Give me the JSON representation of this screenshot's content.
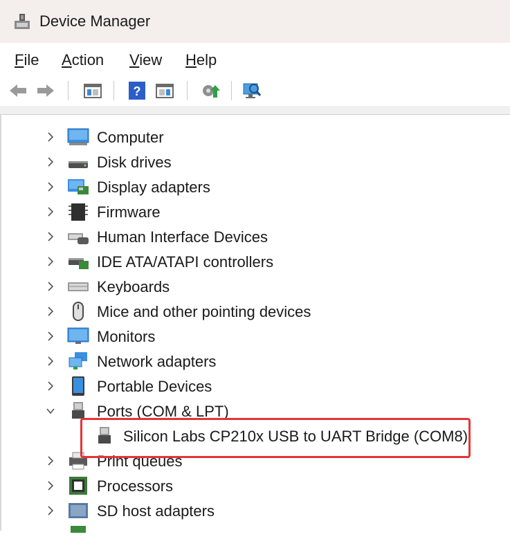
{
  "window": {
    "title": "Device Manager",
    "icon": "device-manager-icon"
  },
  "menu": [
    {
      "label": "File",
      "mnemonic": "F",
      "rest": "ile"
    },
    {
      "label": "Action",
      "mnemonic": "A",
      "rest": "ction"
    },
    {
      "label": "View",
      "mnemonic": "V",
      "rest": "iew"
    },
    {
      "label": "Help",
      "mnemonic": "H",
      "rest": "elp"
    }
  ],
  "toolbar": [
    "back-arrow-icon",
    "forward-arrow-icon",
    "show-hide-console-tree-icon",
    "help-icon",
    "properties-pane-icon",
    "update-driver-icon",
    "scan-hardware-changes-icon"
  ],
  "tree": {
    "items": [
      {
        "label": "Computer",
        "icon": "computer-icon",
        "expanded": false
      },
      {
        "label": "Disk drives",
        "icon": "disk-drive-icon",
        "expanded": false
      },
      {
        "label": "Display adapters",
        "icon": "display-adapter-icon",
        "expanded": false
      },
      {
        "label": "Firmware",
        "icon": "firmware-icon",
        "expanded": false
      },
      {
        "label": "Human Interface Devices",
        "icon": "hid-icon",
        "expanded": false
      },
      {
        "label": "IDE ATA/ATAPI controllers",
        "icon": "ide-controller-icon",
        "expanded": false
      },
      {
        "label": "Keyboards",
        "icon": "keyboard-icon",
        "expanded": false
      },
      {
        "label": "Mice and other pointing devices",
        "icon": "mouse-icon",
        "expanded": false
      },
      {
        "label": "Monitors",
        "icon": "monitor-icon",
        "expanded": false
      },
      {
        "label": "Network adapters",
        "icon": "network-adapter-icon",
        "expanded": false
      },
      {
        "label": "Portable Devices",
        "icon": "portable-device-icon",
        "expanded": false
      },
      {
        "label": "Ports (COM & LPT)",
        "icon": "port-icon",
        "expanded": true
      },
      {
        "label": "Silicon Labs CP210x USB to UART Bridge (COM8)",
        "icon": "port-connector-icon",
        "child": true,
        "highlighted": true
      },
      {
        "label": "Print queues",
        "icon": "printer-icon",
        "expanded": false
      },
      {
        "label": "Processors",
        "icon": "processor-icon",
        "expanded": false
      },
      {
        "label": "SD host adapters",
        "icon": "sd-host-icon",
        "expanded": false
      }
    ]
  },
  "colors": {
    "highlight_border": "#e53434",
    "titlebar_bg": "#f4efed"
  }
}
